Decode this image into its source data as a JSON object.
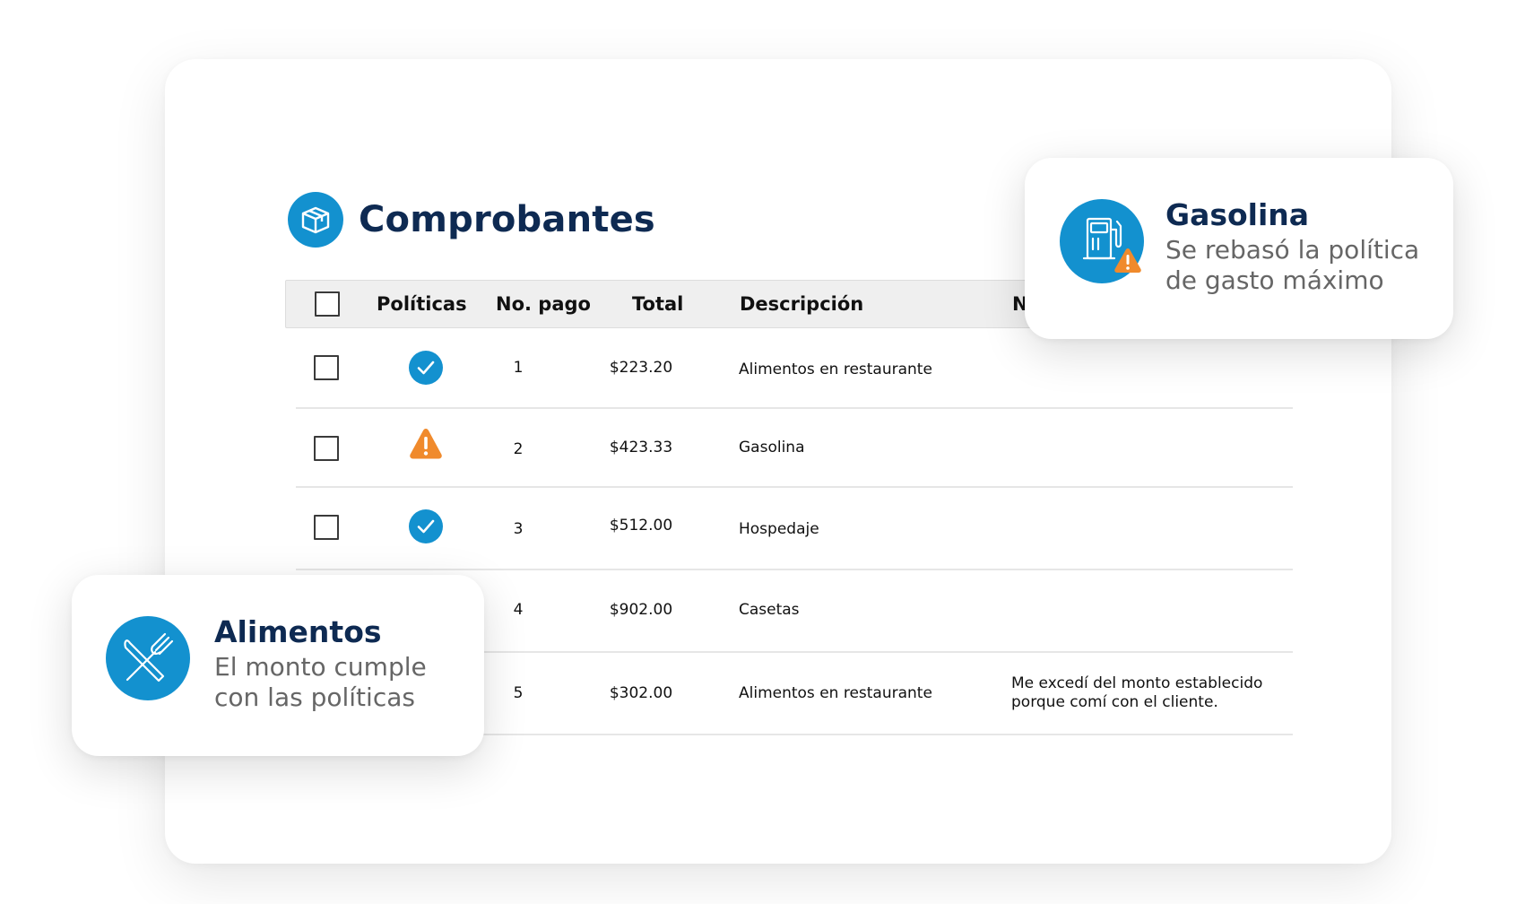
{
  "page": {
    "title": "Comprobantes",
    "title_icon": "box-icon"
  },
  "table": {
    "headers": {
      "politicas": "Políticas",
      "no_pago": "No. pago",
      "total": "Total",
      "descripcion": "Descripción",
      "nota_partial": "N"
    },
    "rows": [
      {
        "status": "ok",
        "no_pago": "1",
        "total": "$223.20",
        "descripcion": "Alimentos en restaurante",
        "nota": ""
      },
      {
        "status": "warning",
        "no_pago": "2",
        "total": "$423.33",
        "descripcion": "Gasolina",
        "nota": ""
      },
      {
        "status": "ok",
        "no_pago": "3",
        "total": "$512.00",
        "descripcion": "Hospedaje",
        "nota": ""
      },
      {
        "status": "ok",
        "no_pago": "4",
        "total": "$902.00",
        "descripcion": "Casetas",
        "nota": ""
      },
      {
        "status": "ok",
        "no_pago": "5",
        "total": "$302.00",
        "descripcion": "Alimentos en restaurante",
        "nota": "Me excedí del monto establecido porque comí con el cliente."
      }
    ]
  },
  "popups": {
    "gasolina": {
      "title": "Gasolina",
      "text": "Se rebasó la política de gasto máximo",
      "icon": "fuel-pump-warning-icon"
    },
    "alimentos": {
      "title": "Alimentos",
      "text": "El monto cumple con las políticas",
      "icon": "fork-knife-icon"
    }
  },
  "colors": {
    "brand_blue": "#1391cf",
    "title_navy": "#0e2a52",
    "warning_orange": "#f08a2c"
  }
}
